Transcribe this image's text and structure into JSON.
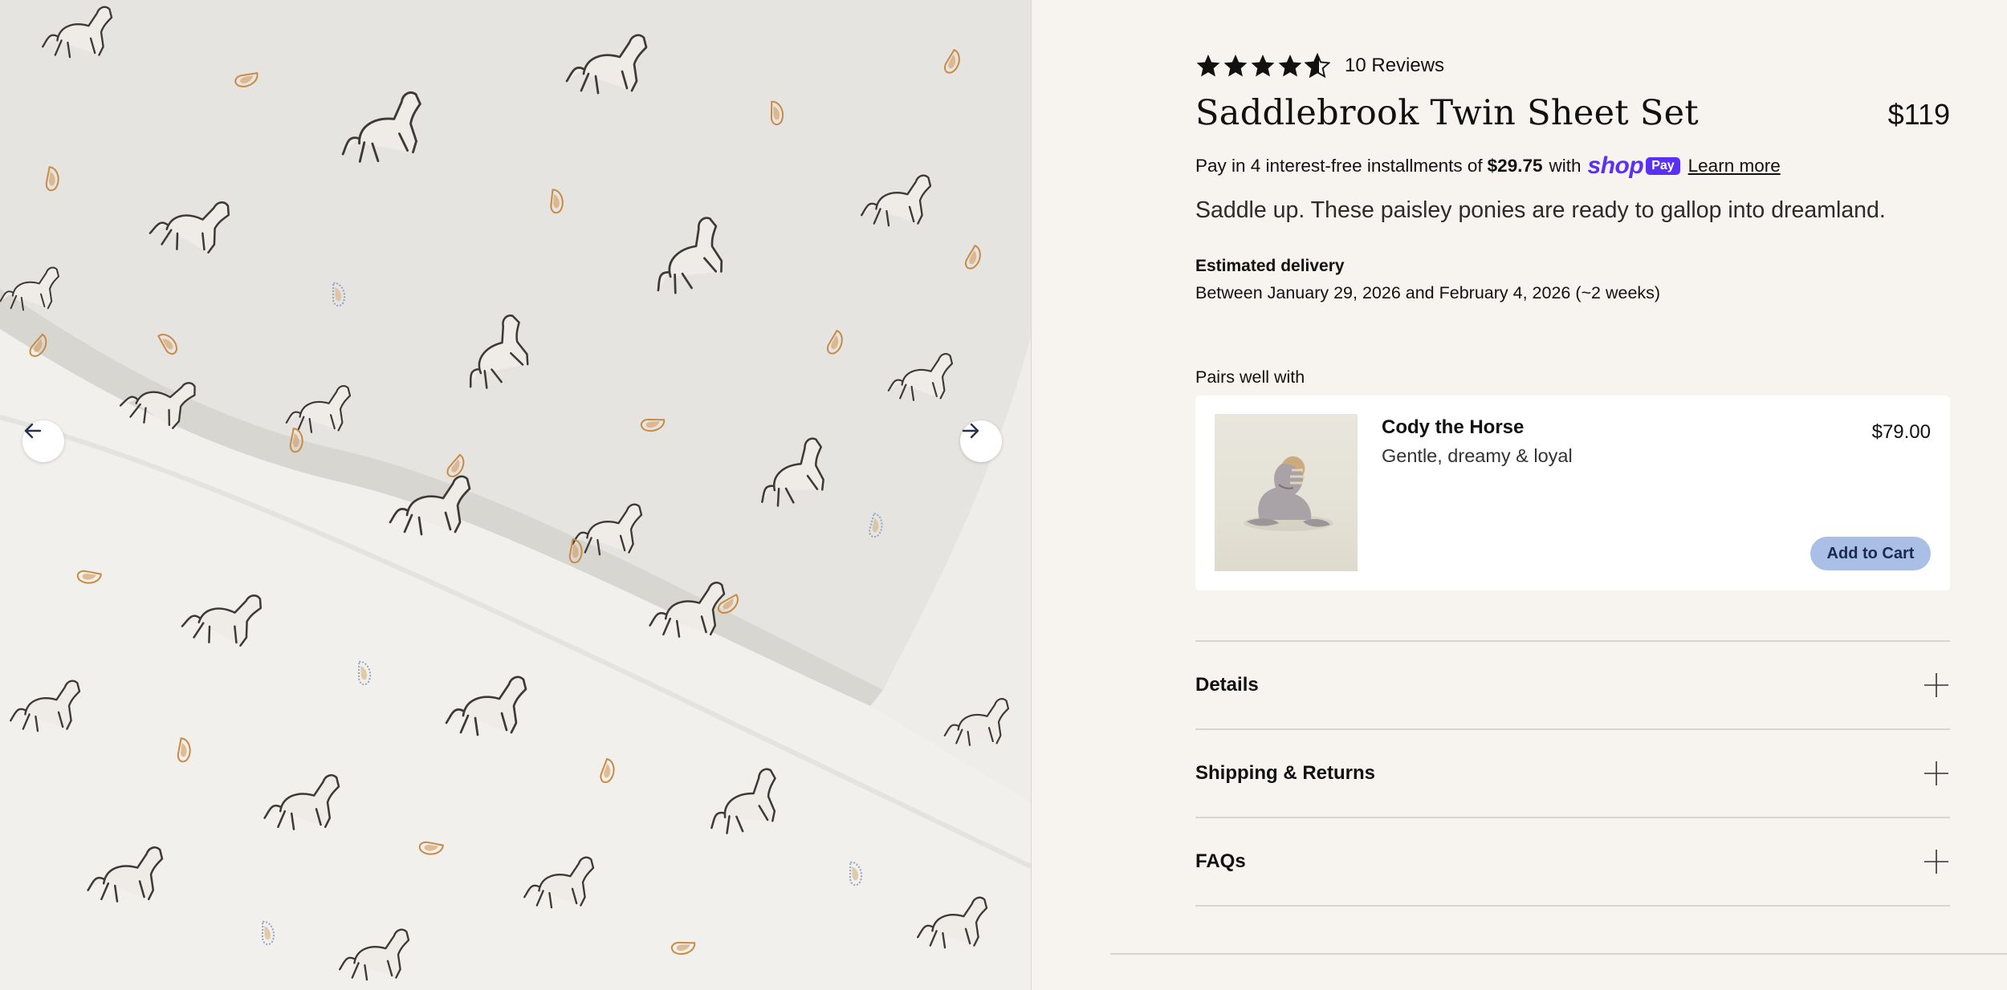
{
  "gallery": {
    "image_subject": "white sheet with horses and paisley print",
    "prev_icon": "arrow-left-icon",
    "next_icon": "arrow-right-icon"
  },
  "product": {
    "rating": 4.5,
    "reviews_label": "10 Reviews",
    "title": "Saddlebrook Twin Sheet Set",
    "price": "$119",
    "installments": {
      "prefix": "Pay in 4 interest-free installments of",
      "amount": "$29.75",
      "suffix": "with",
      "brand_word": "shop",
      "brand_pill": "Pay",
      "learn_more": "Learn more"
    },
    "tagline": "Saddle up. These paisley ponies are ready to gallop into dreamland.",
    "delivery": {
      "label": "Estimated delivery",
      "value": "Between January 29, 2026 and February 4, 2026 (~2 weeks)"
    }
  },
  "pairs": {
    "label": "Pairs well with",
    "item": {
      "name": "Cody the Horse",
      "description": "Gentle, dreamy & loyal",
      "price": "$79.00",
      "button": "Add to Cart"
    }
  },
  "accordion": [
    {
      "label": "Details",
      "icon": "plus-icon"
    },
    {
      "label": "Shipping & Returns",
      "icon": "plus-icon"
    },
    {
      "label": "FAQs",
      "icon": "plus-icon"
    }
  ],
  "colors": {
    "page_bg": "#f7f3ef",
    "shop_pay": "#5a31f4",
    "add_to_cart_bg": "#a9bfe6",
    "nav_arrow": "#24324f"
  }
}
